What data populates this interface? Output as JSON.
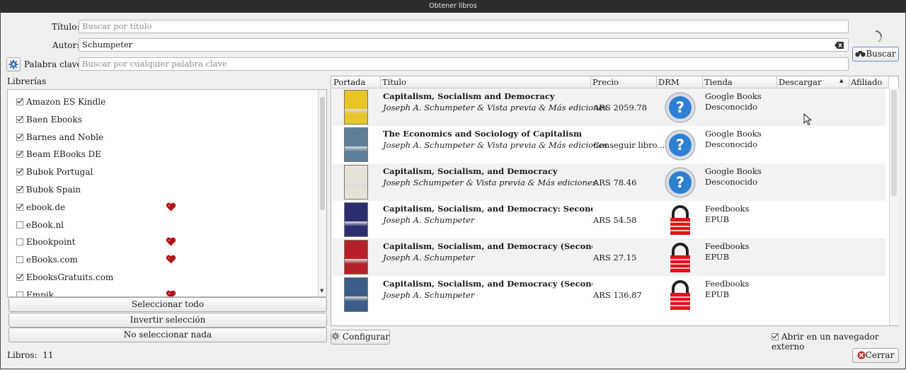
{
  "window": {
    "title": "Obtener libros"
  },
  "search": {
    "title_label": "Título:",
    "title_placeholder": "Buscar por título",
    "author_label": "Autor:",
    "author_value": "Schumpeter",
    "keyword_label": "Palabra clave:",
    "keyword_placeholder": "Buscar por cualquier palabra clave",
    "search_button": "Buscar"
  },
  "libraries": {
    "heading": "Librerías",
    "items": [
      {
        "name": "Amazon ES Kindle",
        "checked": true,
        "favorite": false
      },
      {
        "name": "Baen Ebooks",
        "checked": true,
        "favorite": false
      },
      {
        "name": "Barnes and Noble",
        "checked": true,
        "favorite": false
      },
      {
        "name": "Beam EBooks DE",
        "checked": true,
        "favorite": false
      },
      {
        "name": "Bubok Portugal",
        "checked": true,
        "favorite": false
      },
      {
        "name": "Bubok Spain",
        "checked": true,
        "favorite": false
      },
      {
        "name": "ebook.de",
        "checked": true,
        "favorite": true
      },
      {
        "name": "eBook.nl",
        "checked": false,
        "favorite": false
      },
      {
        "name": "Ebookpoint",
        "checked": false,
        "favorite": true
      },
      {
        "name": "eBooks.com",
        "checked": false,
        "favorite": true
      },
      {
        "name": "EbooksGratuits.com",
        "checked": true,
        "favorite": false
      },
      {
        "name": "Empik",
        "checked": false,
        "favorite": true
      }
    ],
    "select_all": "Seleccionar todo",
    "invert": "Invertir selección",
    "select_none": "No seleccionar nada"
  },
  "results": {
    "columns": [
      "Portada",
      "Título",
      "Precio",
      "DRM",
      "Tienda",
      "Descargar",
      "Afiliado"
    ],
    "rows": [
      {
        "title": "Capitalism, Socialism and Democracy",
        "author": "Joseph A. Schumpeter & Vista previa & Más ediciones",
        "price": "ARS 2059.78",
        "drm": "unknown",
        "store": "Google Books",
        "format": "Desconocido",
        "cover_color": "#e8c62a"
      },
      {
        "title": "The Economics and Sociology of Capitalism",
        "author": "Joseph A. Schumpeter & Vista previa & Más ediciones",
        "price": "Conseguir libro...",
        "drm": "unknown",
        "store": "Google Books",
        "format": "Desconocido",
        "cover_color": "#5d7f99"
      },
      {
        "title": "Capitalism, Socialism, and Democracy",
        "author": "Joseph Schumpeter & Vista previa & Más ediciones",
        "price": "ARS 78.46",
        "drm": "unknown",
        "store": "Google Books",
        "format": "Desconocido",
        "cover_color": "#e6e2d6"
      },
      {
        "title": "Capitalism, Socialism, and Democracy: Second Edition",
        "author": "Joseph A. Schumpeter",
        "price": "ARS 54.58",
        "drm": "locked",
        "store": "Feedbooks",
        "format": "EPUB",
        "cover_color": "#2b2f6e"
      },
      {
        "title": "Capitalism, Socialism, and Democracy (Second Edition",
        "author": "Joseph A. Schumpeter",
        "price": "ARS 27.15",
        "drm": "locked",
        "store": "Feedbooks",
        "format": "EPUB",
        "cover_color": "#b5222a"
      },
      {
        "title": "Capitalism, Socialism, and Democracy (Second Edition",
        "author": "Joseph A. Schumpeter",
        "price": "ARS 136.87",
        "drm": "locked",
        "store": "Feedbooks",
        "format": "EPUB",
        "cover_color": "#3c5c8a"
      }
    ]
  },
  "footer": {
    "configure": "Configurar",
    "open_external": "Abrir en un navegador externo",
    "open_external_checked": true,
    "count_label": "Libros:",
    "count_value": "11",
    "close": "Cerrar"
  },
  "icons": {
    "settings": "gear-icon",
    "search": "binoculars-icon",
    "clear": "clear-text-icon",
    "spinner": "loading-spinner-icon",
    "favorite": "heart-icon",
    "drm_unknown": "question-icon",
    "drm_locked": "lock-icon",
    "close": "close-icon",
    "configure": "gear-icon"
  }
}
